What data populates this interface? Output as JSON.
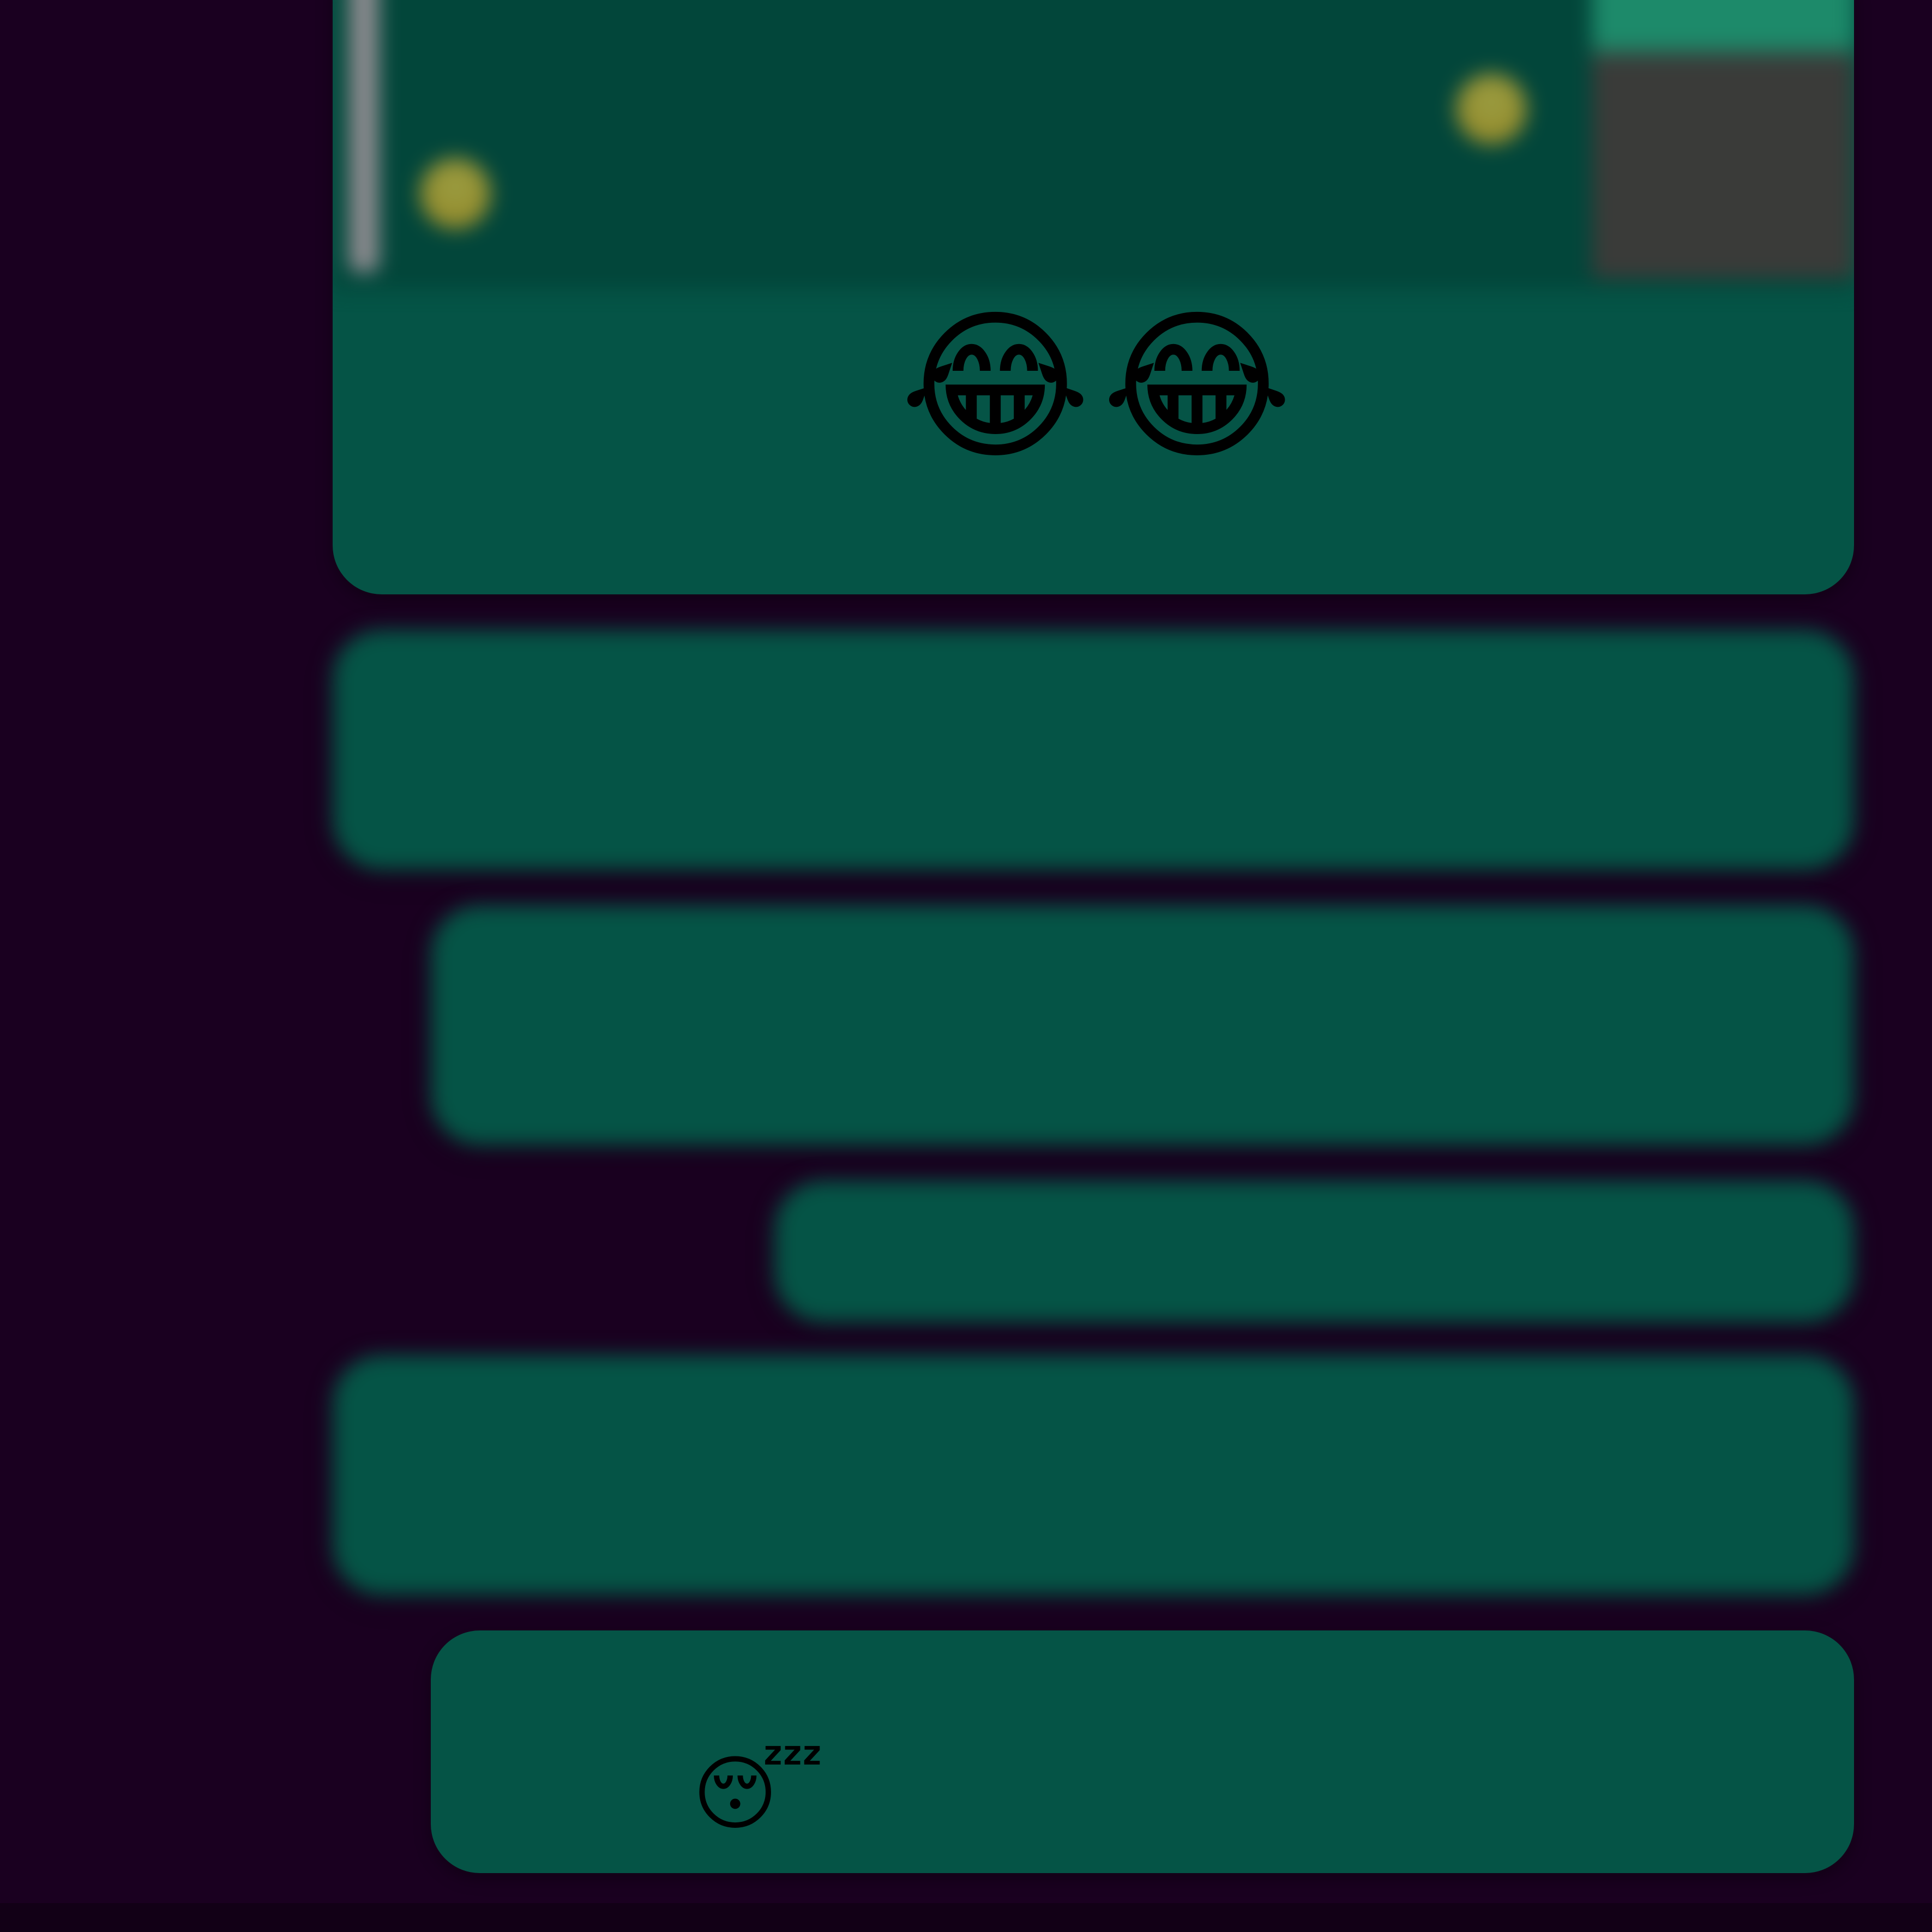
{
  "colors": {
    "background": "#1a0020",
    "bubble": "#055446",
    "quote_background": "#02463a",
    "blurred_text": "#7fb6a8"
  },
  "messages": [
    {
      "type": "reply-with-quote",
      "quote_text_line1": "",
      "quote_text_line2": "",
      "emojis": [
        "😂",
        "😂"
      ],
      "meta": ""
    },
    {
      "type": "text",
      "line1": "",
      "line2": "",
      "meta": ""
    },
    {
      "type": "text",
      "line1": "",
      "line2": "",
      "meta": ""
    },
    {
      "type": "text",
      "line1": "",
      "meta": ""
    },
    {
      "type": "text",
      "line1": "",
      "line2": "",
      "meta": ""
    },
    {
      "type": "text",
      "line1": "",
      "line2": "",
      "emoji": "😴",
      "meta": ""
    }
  ]
}
